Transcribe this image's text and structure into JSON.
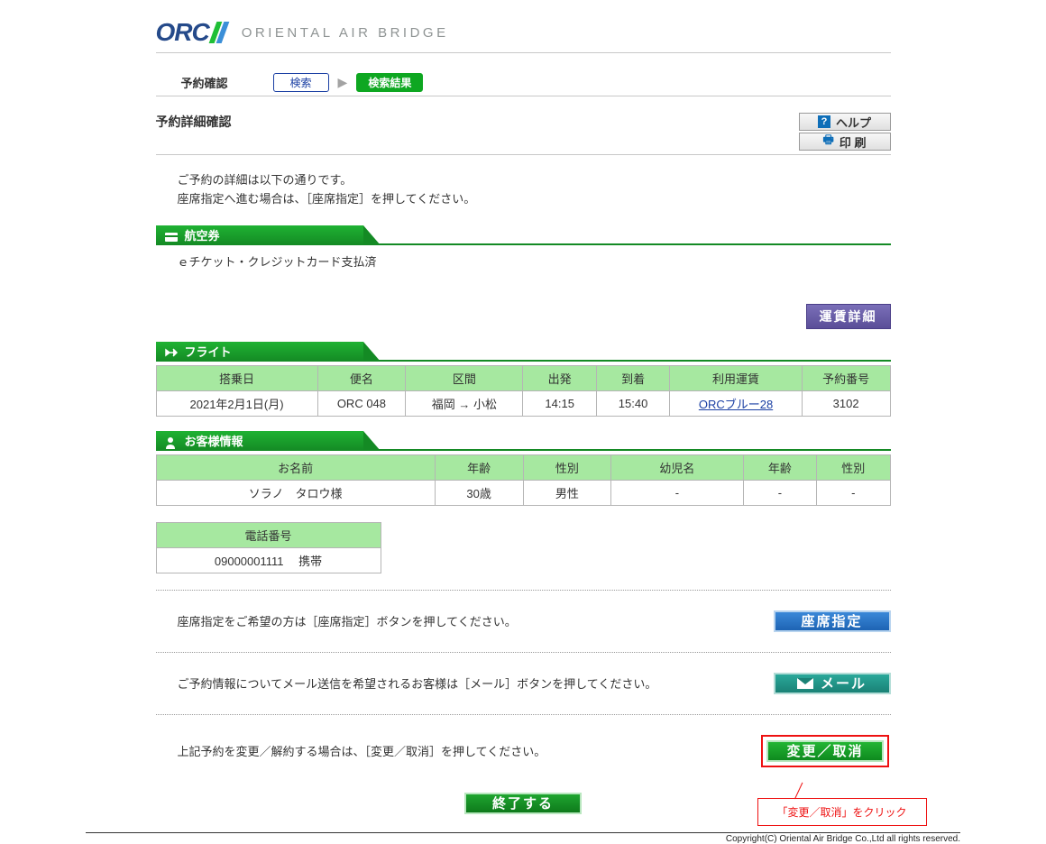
{
  "brand": {
    "logo_main": "ORC",
    "logo_sub": "ORIENTAL AIR BRIDGE"
  },
  "breadcrumb": {
    "label": "予約確認",
    "step1": "検索",
    "step2": "検索結果"
  },
  "title": "予約詳細確認",
  "util": {
    "help": "ヘルプ",
    "print": "印 刷"
  },
  "instructions": {
    "line1": "ご予約の詳細は以下の通りです。",
    "line2": "座席指定へ進む場合は、［座席指定］を押してください。"
  },
  "sections": {
    "ticket": {
      "title": "航空券",
      "body": "ｅチケット・クレジットカード支払済"
    },
    "fare_button": "運賃詳細",
    "flight": {
      "title": "フライト",
      "headers": {
        "date": "搭乗日",
        "flight_no": "便名",
        "segment": "区間",
        "dep": "出発",
        "arr": "到着",
        "fare": "利用運賃",
        "res": "予約番号"
      },
      "row": {
        "date": "2021年2月1日(月)",
        "flight_no": "ORC 048",
        "segment": "福岡 → 小松",
        "dep": "14:15",
        "arr": "15:40",
        "fare": "ORCブルー28",
        "res": "3102"
      }
    },
    "customer": {
      "title": "お客様情報",
      "headers": {
        "name": "お名前",
        "age": "年齢",
        "gender": "性別",
        "infant": "幼児名",
        "age2": "年齢",
        "gender2": "性別"
      },
      "row": {
        "name": "ソラノ　タロウ様",
        "age": "30歳",
        "gender": "男性",
        "infant": "-",
        "age2": "-",
        "gender2": "-"
      },
      "phone_header": "電話番号",
      "phone_value": "09000001111　 携帯"
    }
  },
  "actions": {
    "seat_text": "座席指定をご希望の方は［座席指定］ボタンを押してください。",
    "seat_btn": "座席指定",
    "mail_text": "ご予約情報についてメール送信を希望されるお客様は［メール］ボタンを押してください。",
    "mail_btn": "メール",
    "change_text": "上記予約を変更／解約する場合は、［変更／取消］を押してください。",
    "change_btn": "変更／取消",
    "finish_btn": "終了する"
  },
  "callout": "「変更／取消」をクリック",
  "copyright": "Copyright(C) Oriental Air Bridge Co.,Ltd all rights reserved."
}
